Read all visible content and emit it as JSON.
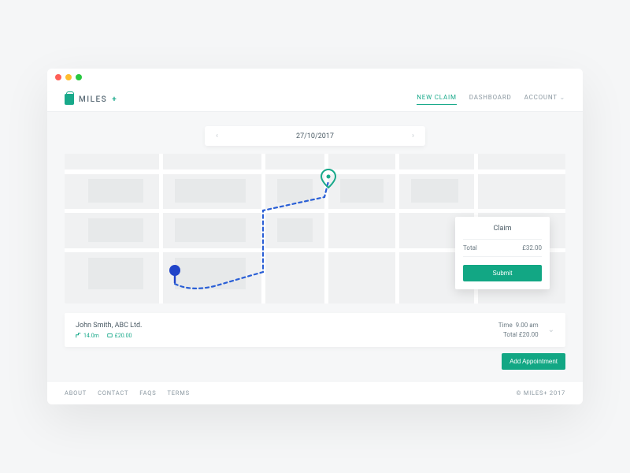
{
  "brand": {
    "name": "MILES",
    "suffix": "+"
  },
  "nav": {
    "items": [
      {
        "label": "NEW CLAIM",
        "active": true
      },
      {
        "label": "DASHBOARD"
      },
      {
        "label": "ACCOUNT",
        "dropdown": true
      }
    ]
  },
  "date_picker": {
    "date": "27/10/2017"
  },
  "claim": {
    "title": "Claim",
    "total_label": "Total",
    "total_value": "£32.00",
    "submit_label": "Submit"
  },
  "appointment": {
    "name": "John Smith, ABC Ltd.",
    "distance": "14.0m",
    "cost": "£20.00",
    "time_label": "Time",
    "time_value": "9.00 am",
    "total_label": "Total",
    "total_value": "£20.00"
  },
  "buttons": {
    "add_appointment": "Add Appointment"
  },
  "footer": {
    "links": [
      "ABOUT",
      "CONTACT",
      "FAQS",
      "TERMS"
    ],
    "copyright": "© MILES+ 2017"
  },
  "colors": {
    "accent": "#12a784",
    "route": "#2a5fd6",
    "pin_end": "#18a98a"
  }
}
